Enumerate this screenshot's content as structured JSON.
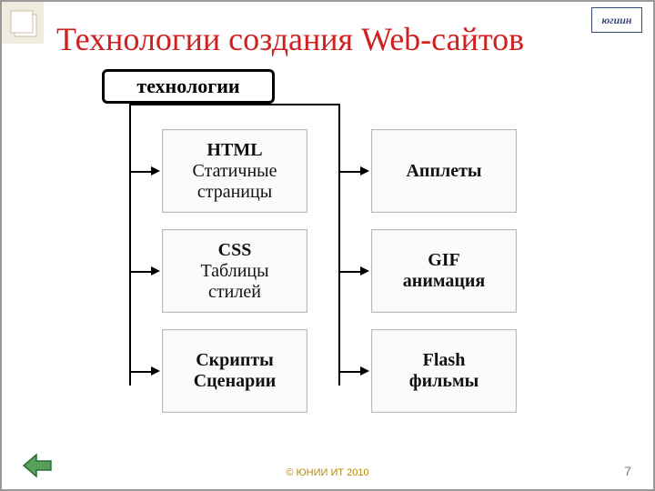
{
  "logo_text": "югиин",
  "title": "Технологии создания Web-сайтов",
  "root_label": "технологии",
  "leaves": {
    "html": {
      "l1": "HTML",
      "l2": "Статичные",
      "l3": "страницы"
    },
    "applet": {
      "l1": "Апплеты"
    },
    "css": {
      "l1": "CSS",
      "l2": "Таблицы",
      "l3": "стилей"
    },
    "gif": {
      "l1": "GIF",
      "l2": "анимация"
    },
    "script": {
      "l1": "Скрипты",
      "l2": "Сценарии"
    },
    "flash": {
      "l1": "Flash",
      "l2": "фильмы"
    }
  },
  "footer": "© ЮНИИ ИТ 2010",
  "page": "7"
}
